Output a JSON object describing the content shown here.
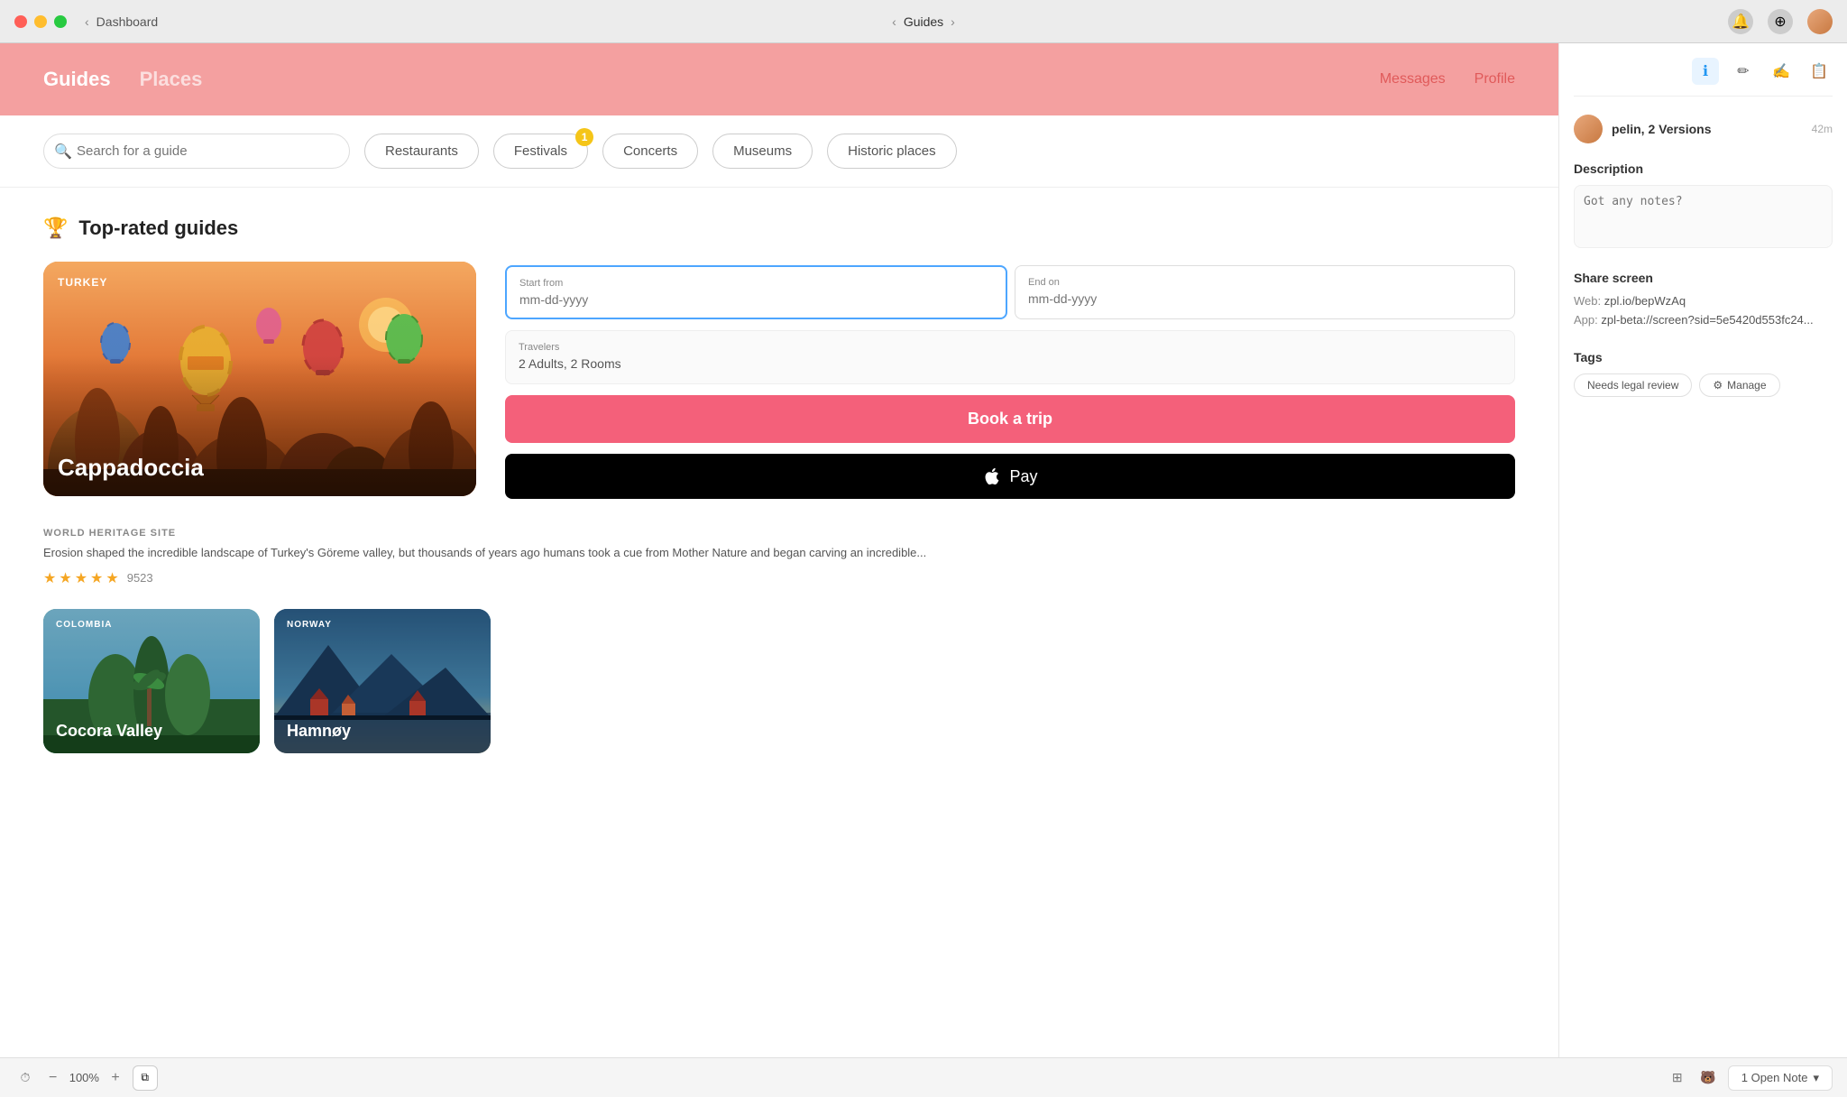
{
  "titlebar": {
    "back_label": "Dashboard",
    "title": "Guides",
    "nav_back": "‹",
    "nav_forward": "›"
  },
  "app": {
    "header": {
      "nav_items": [
        {
          "id": "guides",
          "label": "Guides",
          "active": true
        },
        {
          "id": "places",
          "label": "Places",
          "active": false
        }
      ],
      "actions": [
        {
          "id": "messages",
          "label": "Messages"
        },
        {
          "id": "profile",
          "label": "Profile"
        }
      ]
    },
    "search": {
      "placeholder": "Search for a guide",
      "filters": [
        {
          "id": "restaurants",
          "label": "Restaurants",
          "has_badge": false
        },
        {
          "id": "festivals",
          "label": "Festivals",
          "has_badge": true,
          "badge": "1"
        },
        {
          "id": "concerts",
          "label": "Concerts",
          "has_badge": false
        },
        {
          "id": "museums",
          "label": "Museums",
          "has_badge": false
        },
        {
          "id": "historic",
          "label": "Historic places",
          "has_badge": false
        }
      ]
    },
    "section_title": "Top-rated guides",
    "featured": {
      "country": "TURKEY",
      "name": "Cappadoccia",
      "tag": "WORLD HERITAGE SITE",
      "description": "Erosion shaped the incredible landscape of Turkey's Göreme valley, but thousands of years ago humans took a cue from Mother Nature and began carving an incredible...",
      "rating": 4.5,
      "review_count": "9523"
    },
    "booking": {
      "start_label": "Start from",
      "start_placeholder": "mm-dd-yyyy",
      "end_label": "End on",
      "end_placeholder": "mm-dd-yyyy",
      "travelers_label": "Travelers",
      "travelers_value": "2 Adults, 2 Rooms",
      "book_btn": "Book a trip",
      "apple_pay_label": " Pay"
    },
    "small_cards": [
      {
        "country": "COLOMBIA",
        "name": "Cocora Valley",
        "type": "colombia"
      },
      {
        "country": "NORWAY",
        "name": "Hamnøy",
        "type": "norway"
      }
    ]
  },
  "right_panel": {
    "user": {
      "name": "pelin, 2 Versions",
      "time": "42m"
    },
    "description": {
      "title": "Description",
      "placeholder": "Got any notes?"
    },
    "share": {
      "title": "Share screen",
      "web_label": "Web:",
      "web_url": "zpl.io/bepWzAq",
      "app_label": "App:",
      "app_url": "zpl-beta://screen?sid=5e5420d553fc24..."
    },
    "tags": {
      "title": "Tags",
      "items": [
        {
          "label": "Needs legal review"
        }
      ],
      "manage_label": "Manage"
    }
  },
  "bottom_bar": {
    "zoom": "100%",
    "zoom_minus": "−",
    "zoom_plus": "+",
    "open_note": "1 Open Note"
  }
}
